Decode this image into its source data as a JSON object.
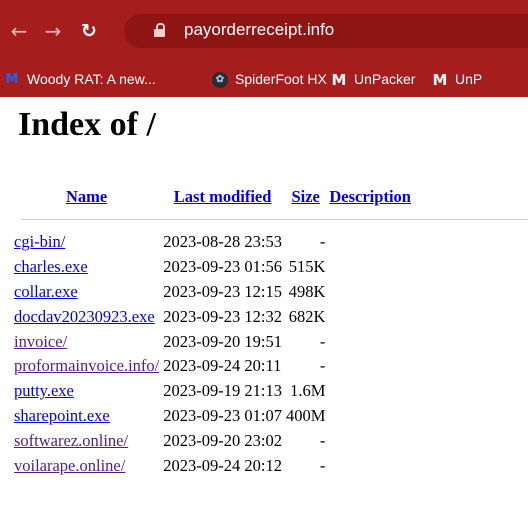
{
  "browser": {
    "url": "payorderreceipt.info",
    "bookmarks": [
      {
        "label": "Woody RAT: A new...",
        "icon": "M"
      },
      {
        "label": "SpiderFoot HX",
        "icon": "spider"
      },
      {
        "label": "UnPacker",
        "icon": "M"
      },
      {
        "label": "UnP",
        "icon": "M"
      }
    ]
  },
  "page": {
    "title": "Index of /",
    "columns": {
      "name": "Name",
      "last_modified": "Last modified",
      "size": "Size",
      "description": "Description"
    },
    "rows": [
      {
        "name": "cgi-bin/",
        "modified": "2023-08-28 23:53",
        "size": "-",
        "visited": false
      },
      {
        "name": "charles.exe",
        "modified": "2023-09-23 01:56",
        "size": "515K",
        "visited": false
      },
      {
        "name": "collar.exe",
        "modified": "2023-09-23 12:15",
        "size": "498K",
        "visited": false
      },
      {
        "name": "docdav20230923.exe",
        "modified": "2023-09-23 12:32",
        "size": "682K",
        "visited": false
      },
      {
        "name": "invoice/",
        "modified": "2023-09-20 19:51",
        "size": "-",
        "visited": true
      },
      {
        "name": "proformainvoice.info/",
        "modified": "2023-09-24 20:11",
        "size": "-",
        "visited": true
      },
      {
        "name": "putty.exe",
        "modified": "2023-09-19 21:13",
        "size": "1.6M",
        "visited": false
      },
      {
        "name": "sharepoint.exe",
        "modified": "2023-09-23 01:07",
        "size": "400M",
        "visited": false
      },
      {
        "name": "softwarez.online/",
        "modified": "2023-09-20 23:02",
        "size": "-",
        "visited": true
      },
      {
        "name": "voilarape.online/",
        "modified": "2023-09-24 20:12",
        "size": "-",
        "visited": true
      }
    ]
  },
  "colors": {
    "chrome": "#a61d1d",
    "omnibox": "#8f1414",
    "link": "#0000ee",
    "visited_link": "#551a8b"
  }
}
